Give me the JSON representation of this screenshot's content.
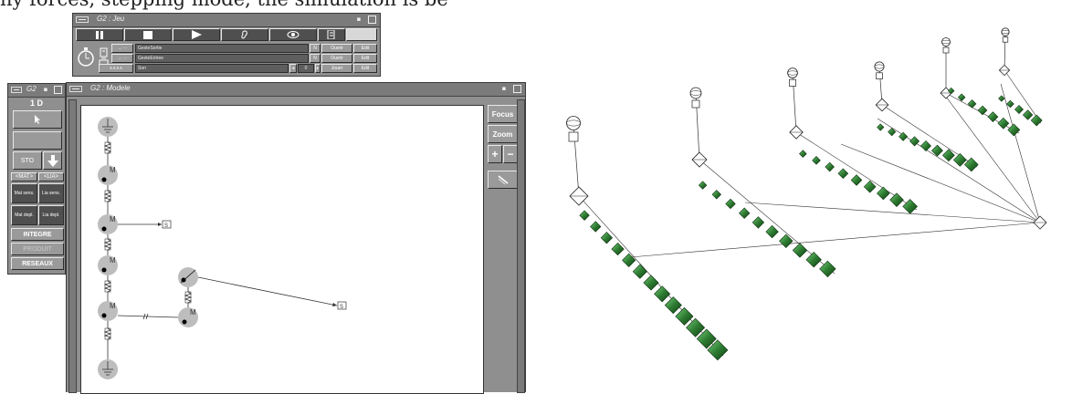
{
  "top_caption": "ny forces, stepping mode, the simulation is be",
  "jeu_window": {
    "title": "G2 : Jeu",
    "rows": [
      {
        "icon": "→ ⋯",
        "name": "GesteSortie",
        "flag": "N",
        "btn1": "Ouvrir",
        "btn2": "Edit"
      },
      {
        "icon": "→ ⋯",
        "name": "GesteEntree",
        "flag": "N",
        "btn1": "Ouvrir",
        "btn2": "Edit"
      },
      {
        "icon": "∧∧∧∧",
        "name": "Son",
        "counter": "0",
        "btn1": "Jouer",
        "btn2": "Edit"
      }
    ]
  },
  "palette": {
    "title": "G2",
    "mode": "1 D",
    "sto": "STO",
    "tab_mat": "<MAT>",
    "tab_lia": "<LIA>",
    "buttons": [
      {
        "label": "Mat sens.",
        "enabled": true
      },
      {
        "label": "Lia sens.",
        "enabled": true
      },
      {
        "label": "Mat depl.",
        "enabled": true
      },
      {
        "label": "Lia depl.",
        "enabled": true
      }
    ],
    "integre": "INTEGRE",
    "produit": "PRODUIT",
    "reseaux": "RESEAUX"
  },
  "model_window": {
    "title": "G2 : Modele",
    "focus": "Focus",
    "zoom": "Zoom",
    "plus": "+",
    "minus": "−",
    "node_label": "M"
  },
  "render_view": {
    "background": "#ffffff",
    "accent": "#2e7d32"
  }
}
